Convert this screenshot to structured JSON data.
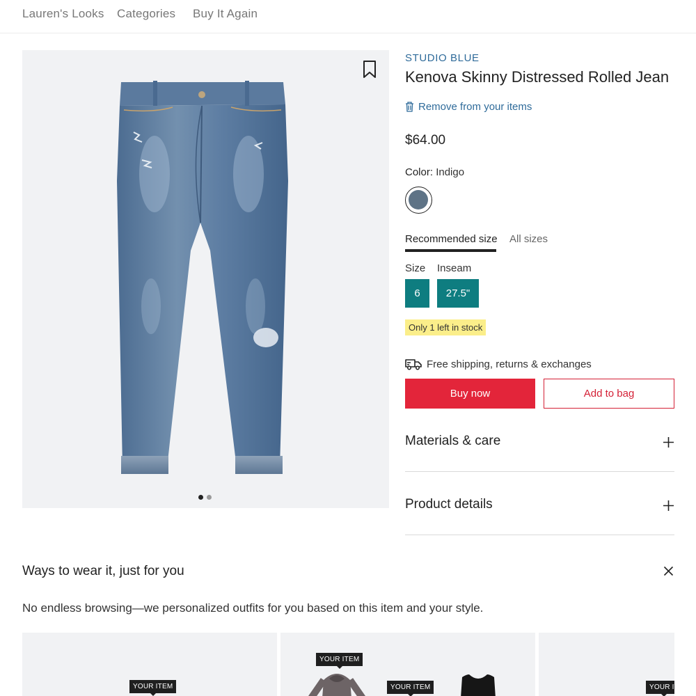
{
  "nav": {
    "items": [
      "Lauren's Looks",
      "Categories",
      "Buy It Again"
    ]
  },
  "gallery": {
    "image_count": 2,
    "active_index": 0
  },
  "product": {
    "brand": "STUDIO BLUE",
    "title": "Kenova Skinny Distressed Rolled Jean",
    "remove_label": "Remove from your items",
    "price": "$64.00",
    "color_label": "Color:",
    "color_value": "Indigo",
    "swatch_color": "#5e7386"
  },
  "size": {
    "tabs": [
      "Recommended size",
      "All sizes"
    ],
    "active_tab": 0,
    "size_label": "Size",
    "inseam_label": "Inseam",
    "size_value": "6",
    "inseam_value": "27.5\""
  },
  "stock": "Only 1 left in stock",
  "shipping": "Free shipping, returns & exchanges",
  "actions": {
    "buy_now": "Buy now",
    "add_to_bag": "Add to bag"
  },
  "accordions": [
    "Materials & care",
    "Product details"
  ],
  "outfits": {
    "title": "Ways to wear it, just for you",
    "subtitle": "No endless browsing—we personalized outfits for you based on this item and your style.",
    "your_item_label": "YOUR ITEM",
    "your_item_label_cut": "YOUR IT"
  },
  "colors": {
    "accent_blue": "#2f6b9a",
    "teal": "#0e7d80",
    "red": "#e3253a",
    "stock_yellow": "#fbee8a"
  }
}
